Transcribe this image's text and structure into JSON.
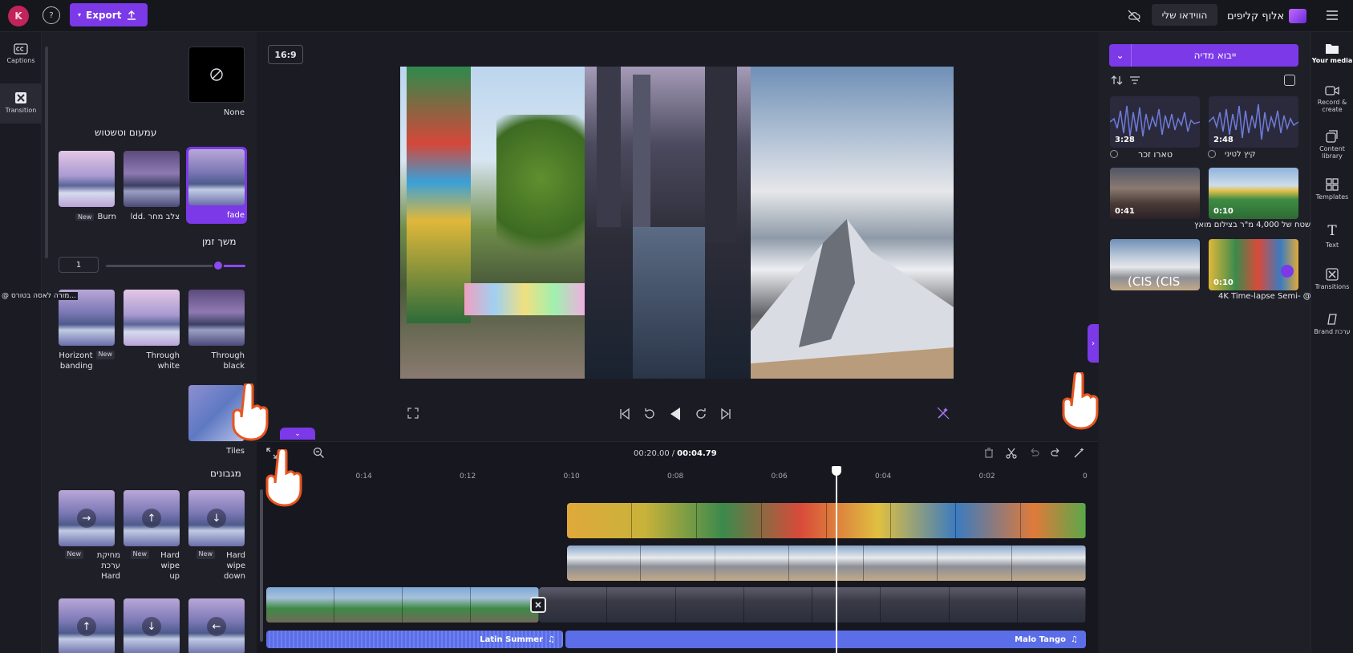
{
  "topbar": {
    "avatar_letter": "K",
    "help_label": "?",
    "export_label": "Export",
    "project_title": "הווידאו שלי",
    "brand_name": "אלוף קליפים"
  },
  "left_rail": {
    "items": [
      {
        "label": "Captions",
        "icon": "captions-icon"
      },
      {
        "label": "Transition",
        "icon": "transition-icon"
      }
    ]
  },
  "transitions_panel": {
    "none_label": "None",
    "section_fades": "עמעום וטשטוש",
    "fade_items": [
      {
        "label": "fade",
        "selected": true
      },
      {
        "label": "ldd. צלב מחר",
        "selected": false
      },
      {
        "label": "Burn",
        "badge": "New"
      }
    ],
    "duration_label": "משך זמן",
    "duration_value": "1",
    "slider_level": 0.2,
    "through_items": [
      {
        "label": "Through black"
      },
      {
        "label": "Through white"
      },
      {
        "label": "Horizont banding",
        "badge": "New"
      }
    ],
    "tooltip_text": "@ מורה לאסה בטורס...",
    "tiles_label": "Tiles",
    "section_wipes": "מגבונים",
    "wipe_items": [
      {
        "label": "Hard wipe down",
        "badge": "New"
      },
      {
        "label": "Hard wipe up",
        "badge": "New"
      },
      {
        "label": "מחיקת ערכת Hard",
        "badge": "New"
      }
    ]
  },
  "preview": {
    "aspect_ratio": "16:9"
  },
  "timeline": {
    "current_time": "00:04.79",
    "total_time": "00:20.00",
    "ticks": [
      "0",
      "0:02",
      "0:04",
      "0:06",
      "0:08",
      "0:10",
      "0:12",
      "0:14"
    ],
    "audio_tracks": [
      {
        "name": "Malo Tango"
      },
      {
        "name": "Latin Summer"
      }
    ]
  },
  "media_panel": {
    "import_label": "ייבוא מדיה",
    "items": [
      {
        "duration": "2:48",
        "label": "קיץ לטיני"
      },
      {
        "duration": "3:28",
        "label": "טארו זכר"
      },
      {
        "duration": "0:10",
        "label": "שטח של 4,000 מ\"ר בצילום מואץ @"
      },
      {
        "duration": "0:41",
        "label": ""
      },
      {
        "duration": "0:10",
        "label": "4K Time-lapse Semi- @"
      },
      {
        "duration": "",
        "label": "(CIS (CIS"
      }
    ]
  },
  "right_rail": {
    "items": [
      {
        "label": "Your media",
        "icon": "folder-icon"
      },
      {
        "label": "Record & create",
        "icon": "record-icon"
      },
      {
        "label": "Content library",
        "icon": "library-icon"
      },
      {
        "label": "Templates",
        "icon": "templates-icon"
      },
      {
        "label": "Text",
        "icon": "text-icon"
      },
      {
        "label": "Transitions",
        "icon": "transitions-icon"
      },
      {
        "label": "Brand ערכת",
        "icon": "brand-kit-icon"
      }
    ]
  },
  "colors": {
    "accent": "#7b39e8",
    "background": "#1b1b24",
    "panel": "#1f1f28",
    "audio": "#5b6ee8"
  }
}
